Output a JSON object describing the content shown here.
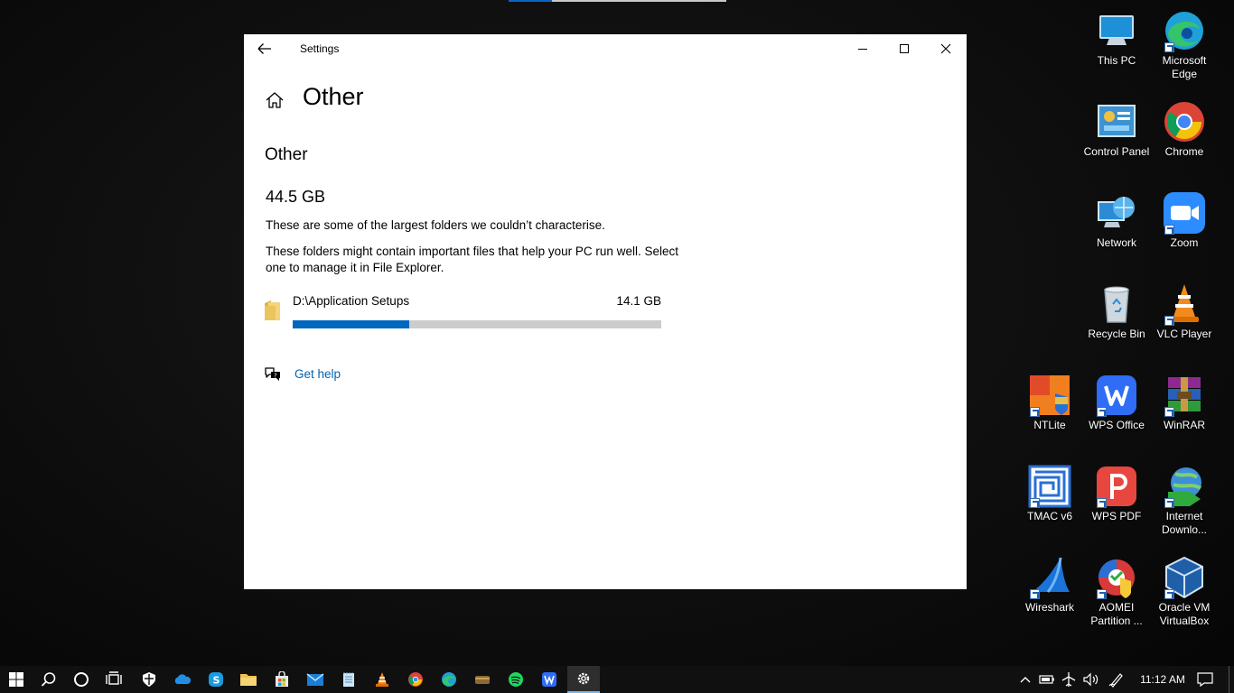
{
  "window": {
    "title": "Settings",
    "page_title": "Other",
    "section_title": "Other",
    "total_size": "44.5 GB",
    "description_1": "These are some of the largest folders we couldn’t characterise.",
    "description_2": "These folders might contain important files that help your PC run well. Select one to manage it in File Explorer.",
    "folders": [
      {
        "name": "D:\\Application Setups",
        "size": "14.1 GB",
        "usage_fraction": 0.317
      }
    ],
    "help_link": "Get help"
  },
  "desktop_icons": [
    {
      "label": "This PC",
      "icon": "this-pc-icon"
    },
    {
      "label": "Microsoft Edge",
      "icon": "edge-icon"
    },
    {
      "label": "Control Panel",
      "icon": "control-panel-icon"
    },
    {
      "label": "Chrome",
      "icon": "chrome-icon"
    },
    {
      "label": "Network",
      "icon": "network-icon"
    },
    {
      "label": "Zoom",
      "icon": "zoom-icon"
    },
    {
      "label": "Recycle Bin",
      "icon": "recycle-bin-icon"
    },
    {
      "label": "VLC Player",
      "icon": "vlc-icon"
    },
    {
      "label": "NTLite",
      "icon": "ntlite-icon"
    },
    {
      "label": "WPS Office",
      "icon": "wps-office-icon"
    },
    {
      "label": "WinRAR",
      "icon": "winrar-icon"
    },
    {
      "label": "TMAC v6",
      "icon": "tmac-icon"
    },
    {
      "label": "WPS PDF",
      "icon": "wps-pdf-icon"
    },
    {
      "label": "Internet Downlo...",
      "icon": "idm-icon"
    },
    {
      "label": "Wireshark",
      "icon": "wireshark-icon"
    },
    {
      "label": "AOMEI Partition ...",
      "icon": "aomei-icon"
    },
    {
      "label": "Oracle VM VirtualBox",
      "icon": "virtualbox-icon"
    }
  ],
  "taskbar": {
    "clock": "11:12 AM",
    "accent": "#0067c0"
  }
}
